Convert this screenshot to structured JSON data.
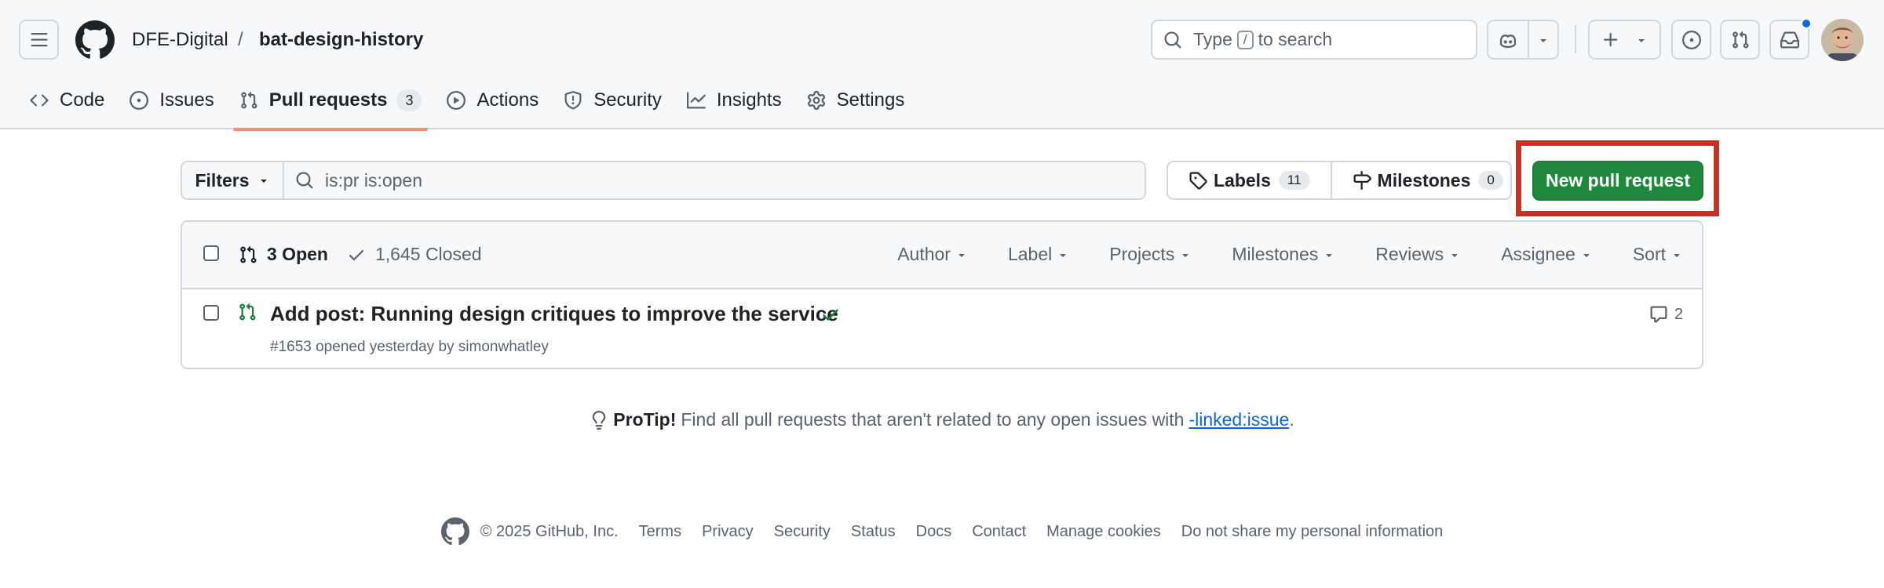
{
  "header": {
    "owner": "DFE-Digital",
    "separator": "/",
    "repo": "bat-design-history",
    "search": {
      "prefix": "Type",
      "key": "/",
      "suffix": "to search"
    }
  },
  "tabs": [
    {
      "label": "Code",
      "icon": "code-icon"
    },
    {
      "label": "Issues",
      "icon": "issue-opened-icon"
    },
    {
      "label": "Pull requests",
      "icon": "git-pull-request-icon",
      "count": "3",
      "active": true
    },
    {
      "label": "Actions",
      "icon": "play-icon"
    },
    {
      "label": "Security",
      "icon": "shield-icon"
    },
    {
      "label": "Insights",
      "icon": "graph-icon"
    },
    {
      "label": "Settings",
      "icon": "gear-icon"
    }
  ],
  "filter_bar": {
    "filters_label": "Filters",
    "query": "is:pr is:open",
    "labels_label": "Labels",
    "labels_count": "11",
    "milestones_label": "Milestones",
    "milestones_count": "0",
    "new_pr_label": "New pull request"
  },
  "list": {
    "open_label": "3 Open",
    "closed_label": "1,645 Closed",
    "sort_menus": [
      "Author",
      "Label",
      "Projects",
      "Milestones",
      "Reviews",
      "Assignee",
      "Sort"
    ],
    "rows": [
      {
        "title": "Add post: Running design critiques to improve the service",
        "meta": "#1653 opened yesterday by simonwhatley",
        "comments": "2",
        "status": "success"
      }
    ]
  },
  "protip": {
    "label": "ProTip!",
    "text": "Find all pull requests that aren't related to any open issues with",
    "link": "-linked:issue",
    "end": "."
  },
  "footer": {
    "copyright": "© 2025 GitHub, Inc.",
    "links": [
      "Terms",
      "Privacy",
      "Security",
      "Status",
      "Docs",
      "Contact",
      "Manage cookies",
      "Do not share my personal information"
    ]
  },
  "colors": {
    "accent_green": "#1f883d",
    "active_tab_underline": "#fd8c73",
    "highlight_box": "#c93021",
    "link_blue": "#0969da"
  }
}
